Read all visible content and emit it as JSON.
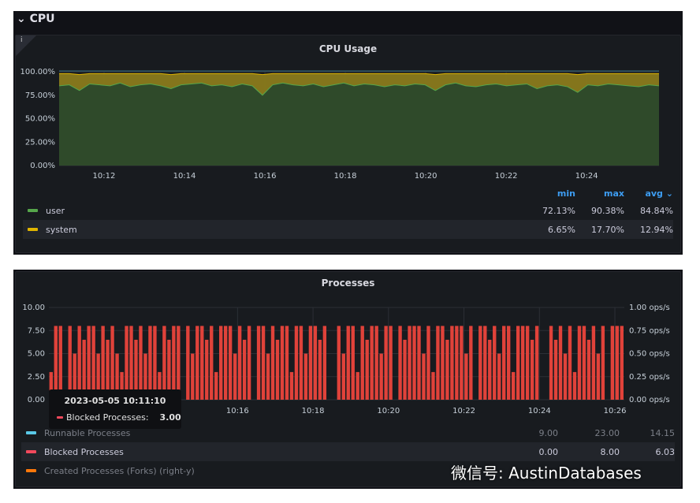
{
  "row": {
    "title": "CPU",
    "chevron": "chevron-down-icon"
  },
  "cpu": {
    "title": "CPU Usage",
    "info": "i",
    "legend": {
      "headers": [
        "min",
        "max",
        "avg"
      ],
      "sort_icon": "chevron-down-icon",
      "items": [
        {
          "name": "user",
          "color": "#56a64b",
          "min": "72.13%",
          "max": "90.38%",
          "avg": "84.84%"
        },
        {
          "name": "system",
          "color": "#e0b400",
          "min": "6.65%",
          "max": "17.70%",
          "avg": "12.94%"
        }
      ]
    }
  },
  "processes": {
    "title": "Processes",
    "legend": {
      "items": [
        {
          "name": "Runnable Processes",
          "color": "#5ac8e6",
          "min": "9.00",
          "max": "23.00",
          "avg": "14.15",
          "dim": true
        },
        {
          "name": "Blocked Processes",
          "color": "#f2495c",
          "min": "0.00",
          "max": "8.00",
          "avg": "6.03",
          "dim": false
        },
        {
          "name": "Created Processes (Forks) (right-y)",
          "color": "#ff780a",
          "min": "",
          "max": "",
          "avg": "",
          "dim": true
        }
      ]
    },
    "tooltip": {
      "time": "2023-05-05 10:11:10",
      "series": "Blocked Processes:",
      "value": "3.00"
    }
  },
  "watermark": "微信号: AustinDatabases",
  "chart_data": [
    {
      "type": "area",
      "title": "CPU Usage",
      "stacked": true,
      "x_range": [
        "10:10:53",
        "10:25:48"
      ],
      "xticks": [
        "10:12",
        "10:14",
        "10:16",
        "10:18",
        "10:20",
        "10:22",
        "10:24"
      ],
      "yticks": [
        "0.00%",
        "25.00%",
        "50.00%",
        "75.00%",
        "100.00%"
      ],
      "ylim": [
        0,
        100
      ],
      "grid": true,
      "series": [
        {
          "name": "user",
          "color": "#56a64b",
          "values": [
            85,
            86,
            80,
            87,
            86,
            85,
            88,
            84,
            86,
            87,
            85,
            82,
            86,
            87,
            88,
            85,
            86,
            84,
            87,
            85,
            75,
            86,
            88,
            86,
            85,
            87,
            84,
            86,
            88,
            85,
            87,
            86,
            84,
            86,
            85,
            87,
            86,
            80,
            86,
            88,
            85,
            84,
            86,
            87,
            85,
            86,
            87,
            82,
            85,
            86,
            84,
            78,
            86,
            85,
            87,
            86,
            85,
            84,
            86,
            85
          ]
        },
        {
          "name": "system",
          "color": "#e0b400",
          "values": [
            13,
            12,
            17,
            11,
            12,
            13,
            10,
            14,
            12,
            11,
            13,
            15,
            12,
            11,
            10,
            13,
            12,
            14,
            11,
            13,
            22,
            12,
            10,
            12,
            13,
            11,
            14,
            12,
            10,
            13,
            11,
            12,
            14,
            12,
            13,
            11,
            12,
            17,
            12,
            10,
            13,
            14,
            12,
            11,
            13,
            12,
            11,
            16,
            13,
            12,
            14,
            19,
            12,
            13,
            11,
            12,
            13,
            14,
            12,
            13
          ]
        }
      ]
    },
    {
      "type": "bar",
      "title": "Processes",
      "x_range": [
        "10:11",
        "10:26:15"
      ],
      "xticks": [
        "10:16",
        "10:18",
        "10:20",
        "10:22",
        "10:24",
        "10:26"
      ],
      "yticks": [
        "0.00",
        "2.50",
        "5.00",
        "7.50",
        "10.00"
      ],
      "ylim": [
        0,
        10
      ],
      "y2ticks": [
        "0.00 ops/s",
        "0.25 ops/s",
        "0.50 ops/s",
        "0.75 ops/s",
        "1.00 ops/s"
      ],
      "y2lim": [
        0,
        1
      ],
      "series": [
        {
          "name": "Blocked Processes",
          "color": "#f2495c",
          "values": [
            3,
            8,
            8,
            0,
            8,
            5,
            8,
            6.5,
            8,
            8,
            5,
            8,
            6.5,
            8,
            5,
            3,
            8,
            8,
            6.5,
            8,
            5,
            8,
            8,
            3,
            8,
            6.5,
            8,
            8,
            0,
            8,
            5,
            8,
            8,
            6.5,
            8,
            3,
            8,
            8,
            8,
            5,
            8,
            6.5,
            8,
            0,
            8,
            8,
            5,
            8,
            6.5,
            8,
            8,
            3,
            8,
            8,
            5,
            8,
            8,
            6.5,
            8,
            0,
            0,
            8,
            5,
            8,
            8,
            3,
            8,
            6.5,
            8,
            8,
            5,
            8,
            8,
            0,
            8,
            6.5,
            8,
            8,
            8,
            5,
            8,
            3,
            8,
            8,
            6.5,
            8,
            8,
            8,
            5,
            8,
            0,
            8,
            8,
            6.5,
            8,
            5,
            8,
            8,
            3,
            8,
            8,
            8,
            6.5,
            8,
            0,
            0,
            8,
            6.5,
            8,
            5,
            8,
            3,
            8,
            8,
            6.5,
            8,
            5,
            8,
            0,
            8,
            8,
            8
          ]
        }
      ]
    }
  ]
}
